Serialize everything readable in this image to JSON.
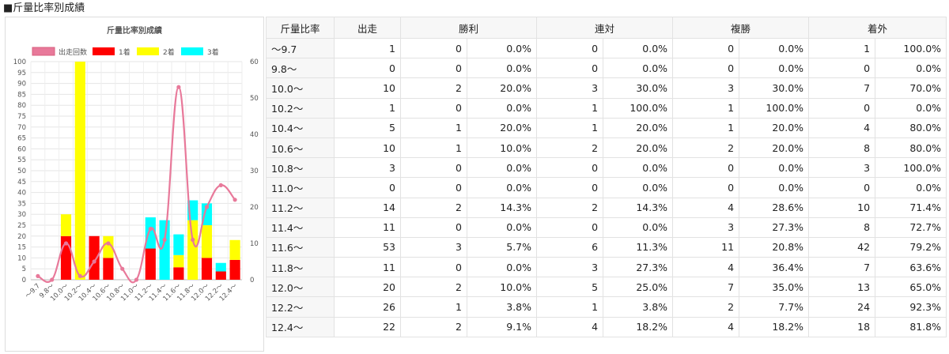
{
  "page": {
    "title": "■斤量比率別成績"
  },
  "table": {
    "headers": [
      "斤量比率",
      "出走",
      "勝利",
      "連対",
      "複勝",
      "着外"
    ],
    "rows": [
      [
        "〜9.7",
        "1",
        "0",
        "0.0%",
        "0",
        "0.0%",
        "0",
        "0.0%",
        "1",
        "100.0%"
      ],
      [
        "9.8〜",
        "0",
        "0",
        "0.0%",
        "0",
        "0.0%",
        "0",
        "0.0%",
        "0",
        "0.0%"
      ],
      [
        "10.0〜",
        "10",
        "2",
        "20.0%",
        "3",
        "30.0%",
        "3",
        "30.0%",
        "7",
        "70.0%"
      ],
      [
        "10.2〜",
        "1",
        "0",
        "0.0%",
        "1",
        "100.0%",
        "1",
        "100.0%",
        "0",
        "0.0%"
      ],
      [
        "10.4〜",
        "5",
        "1",
        "20.0%",
        "1",
        "20.0%",
        "1",
        "20.0%",
        "4",
        "80.0%"
      ],
      [
        "10.6〜",
        "10",
        "1",
        "10.0%",
        "2",
        "20.0%",
        "2",
        "20.0%",
        "8",
        "80.0%"
      ],
      [
        "10.8〜",
        "3",
        "0",
        "0.0%",
        "0",
        "0.0%",
        "0",
        "0.0%",
        "3",
        "100.0%"
      ],
      [
        "11.0〜",
        "0",
        "0",
        "0.0%",
        "0",
        "0.0%",
        "0",
        "0.0%",
        "0",
        "0.0%"
      ],
      [
        "11.2〜",
        "14",
        "2",
        "14.3%",
        "2",
        "14.3%",
        "4",
        "28.6%",
        "10",
        "71.4%"
      ],
      [
        "11.4〜",
        "11",
        "0",
        "0.0%",
        "0",
        "0.0%",
        "3",
        "27.3%",
        "8",
        "72.7%"
      ],
      [
        "11.6〜",
        "53",
        "3",
        "5.7%",
        "6",
        "11.3%",
        "11",
        "20.8%",
        "42",
        "79.2%"
      ],
      [
        "11.8〜",
        "11",
        "0",
        "0.0%",
        "3",
        "27.3%",
        "4",
        "36.4%",
        "7",
        "63.6%"
      ],
      [
        "12.0〜",
        "20",
        "2",
        "10.0%",
        "5",
        "25.0%",
        "7",
        "35.0%",
        "13",
        "65.0%"
      ],
      [
        "12.2〜",
        "26",
        "1",
        "3.8%",
        "1",
        "3.8%",
        "2",
        "7.7%",
        "24",
        "92.3%"
      ],
      [
        "12.4〜",
        "22",
        "2",
        "9.1%",
        "4",
        "18.2%",
        "4",
        "18.2%",
        "18",
        "81.8%"
      ]
    ]
  },
  "chart_data": {
    "type": "bar",
    "title": "斤量比率別成績",
    "categories": [
      "〜9.7",
      "9.8〜",
      "10.0〜",
      "10.2〜",
      "10.4〜",
      "10.6〜",
      "10.8〜",
      "11.0〜",
      "11.2〜",
      "11.4〜",
      "11.6〜",
      "11.8〜",
      "12.0〜",
      "12.2〜",
      "12.4〜"
    ],
    "y_left": {
      "range": [
        0,
        100
      ],
      "step": 5
    },
    "y_right": {
      "range": [
        0,
        60
      ],
      "step": 10
    },
    "legend_position": "top",
    "series": [
      {
        "name": "出走回数",
        "kind": "line",
        "axis": "right",
        "color": "#e8799a",
        "values": [
          1,
          0,
          10,
          1,
          5,
          10,
          3,
          0,
          14,
          11,
          53,
          11,
          20,
          26,
          22
        ]
      },
      {
        "name": "1着",
        "kind": "bar",
        "axis": "left",
        "stack": true,
        "color": "#ff0000",
        "values": [
          0,
          0,
          20,
          0,
          20,
          10,
          0,
          0,
          14.3,
          0,
          5.7,
          0,
          10,
          3.8,
          9.1
        ]
      },
      {
        "name": "2着",
        "kind": "bar",
        "axis": "left",
        "stack": true,
        "color": "#ffff00",
        "values": [
          0,
          0,
          10,
          100,
          0,
          10,
          0,
          0,
          0,
          0,
          5.6,
          27.3,
          15,
          0,
          9.1
        ]
      },
      {
        "name": "3着",
        "kind": "bar",
        "axis": "left",
        "stack": true,
        "color": "#00ffff",
        "values": [
          0,
          0,
          0,
          0,
          0,
          0,
          0,
          0,
          14.3,
          27.3,
          9.5,
          9.1,
          10,
          3.9,
          0
        ]
      }
    ]
  }
}
